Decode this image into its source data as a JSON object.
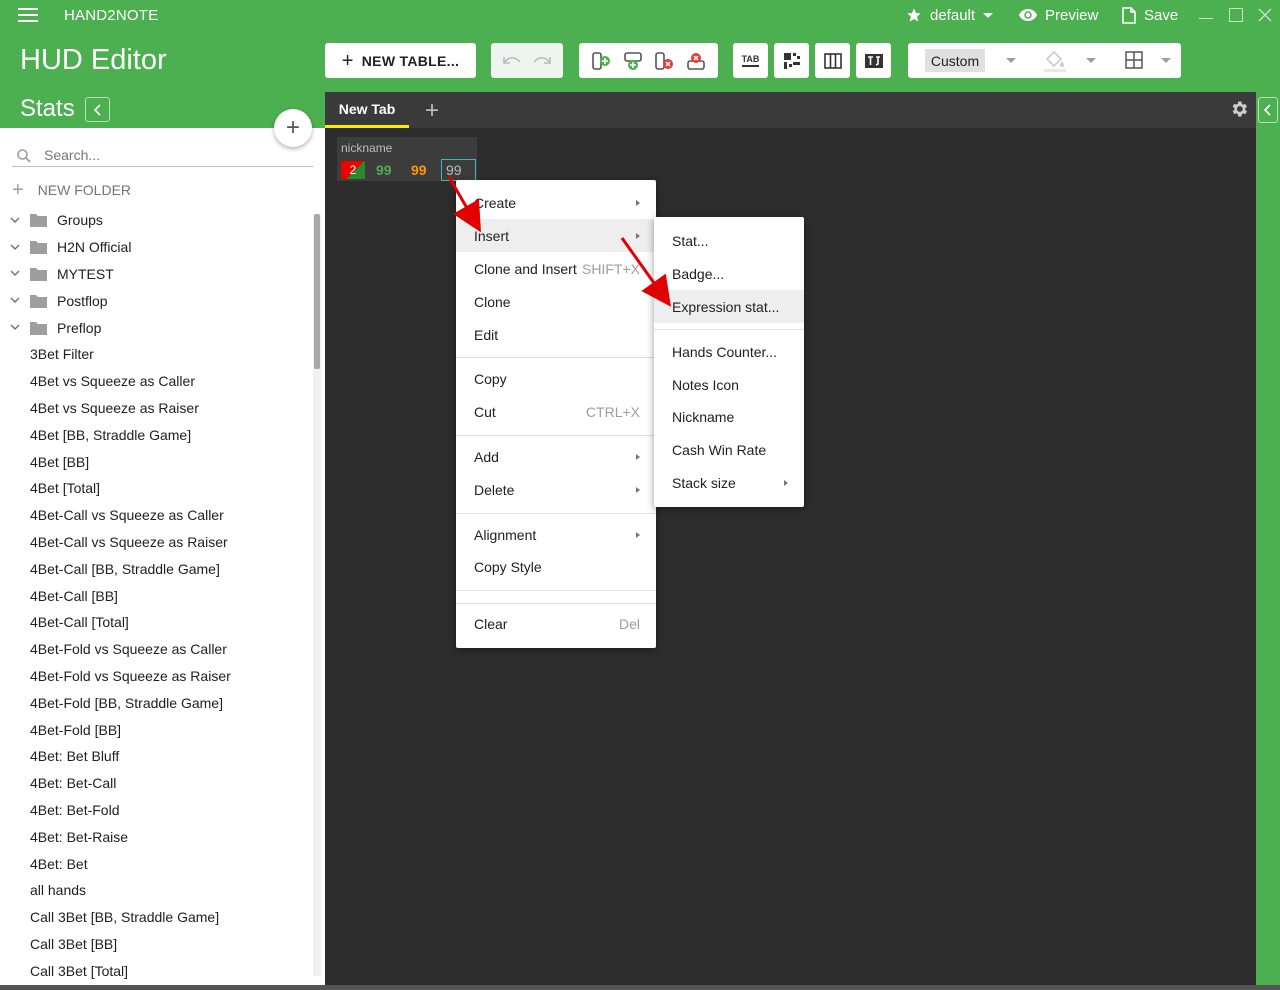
{
  "app": {
    "name": "HAND2NOTE",
    "profile": "default",
    "preview_label": "Preview",
    "save_label": "Save"
  },
  "header": {
    "title": "HUD Editor",
    "section": "Stats"
  },
  "toolbar": {
    "new_table_label": "NEW TABLE...",
    "tab_icon_text": "TAB",
    "style_value": "Custom"
  },
  "sidebar": {
    "search_placeholder": "Search...",
    "new_folder_label": "NEW FOLDER",
    "folders": [
      "Groups",
      "H2N Official",
      "MYTEST",
      "Postflop",
      "Preflop"
    ],
    "items": [
      "3Bet Filter",
      "4Bet vs Squeeze as Caller",
      "4Bet vs Squeeze as Raiser",
      "4Bet [BB, Straddle Game]",
      "4Bet [BB]",
      "4Bet [Total]",
      "4Bet-Call vs Squeeze as Caller",
      "4Bet-Call vs Squeeze as Raiser",
      "4Bet-Call [BB, Straddle Game]",
      "4Bet-Call [BB]",
      "4Bet-Call [Total]",
      "4Bet-Fold vs Squeeze as Caller",
      "4Bet-Fold vs Squeeze as Raiser",
      "4Bet-Fold [BB, Straddle Game]",
      "4Bet-Fold [BB]",
      "4Bet: Bet Bluff",
      "4Bet: Bet-Call",
      "4Bet: Bet-Fold",
      "4Bet: Bet-Raise",
      "4Bet: Bet",
      "all hands",
      "Call 3Bet [BB, Straddle Game]",
      "Call 3Bet [BB]",
      "Call 3Bet [Total]"
    ]
  },
  "tabs": [
    {
      "label": "New Tab",
      "active": true
    }
  ],
  "hud": {
    "nickname": "nickname",
    "badge": "2",
    "stats": [
      "99",
      "99",
      "99"
    ]
  },
  "context_menu": {
    "create": "Create",
    "insert": "Insert",
    "clone_insert": "Clone and Insert",
    "clone_insert_shortcut": "SHIFT+X",
    "clone": "Clone",
    "edit": "Edit",
    "copy": "Copy",
    "cut": "Cut",
    "cut_shortcut": "CTRL+X",
    "add": "Add",
    "delete": "Delete",
    "alignment": "Alignment",
    "copy_style": "Copy Style",
    "clear": "Clear",
    "clear_shortcut": "Del"
  },
  "submenu": {
    "stat": "Stat...",
    "badge": "Badge...",
    "expression_stat": "Expression stat...",
    "hands_counter": "Hands Counter...",
    "notes_icon": "Notes Icon",
    "nickname": "Nickname",
    "cash_win_rate": "Cash Win Rate",
    "stack_size": "Stack size"
  },
  "colors": {
    "brand_green": "#4caf50",
    "canvas_dark": "#2d2d2d",
    "tab_underline": "#ffeb00",
    "annotation_arrow": "#e00000"
  }
}
